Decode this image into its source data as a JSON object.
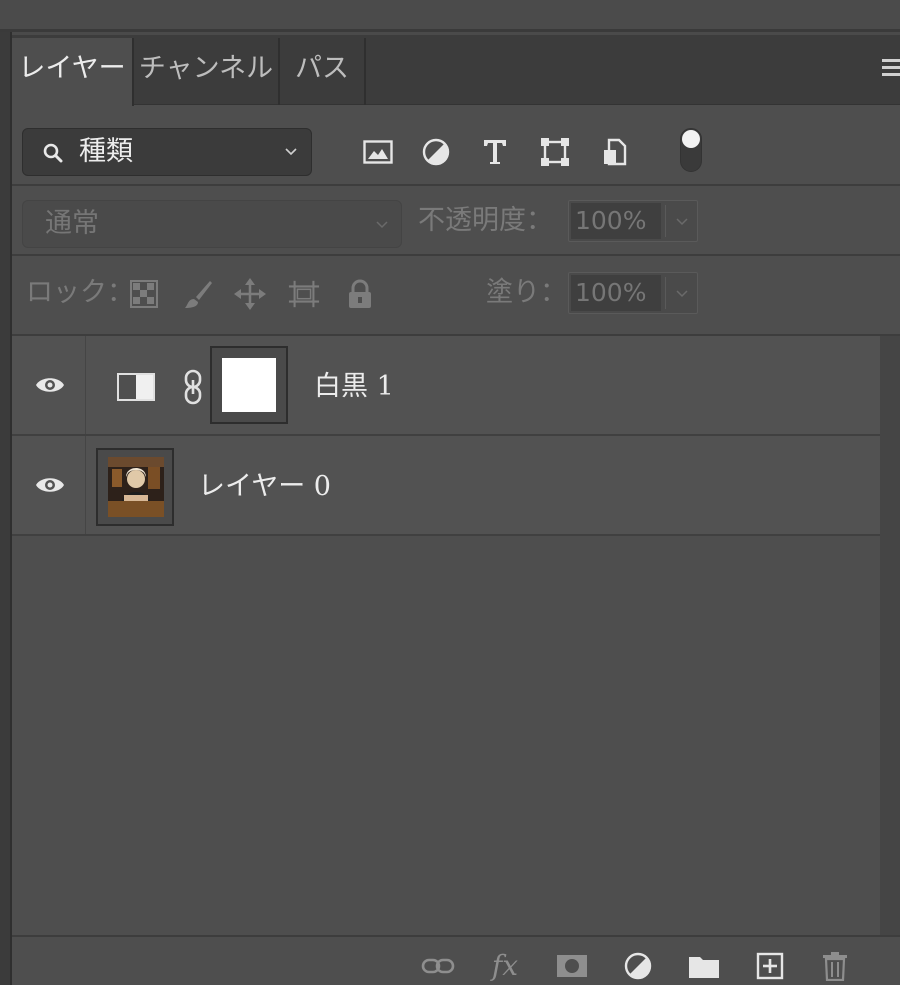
{
  "tabs": [
    {
      "label": "レイヤー",
      "active": true
    },
    {
      "label": "チャンネル",
      "active": false
    },
    {
      "label": "パス",
      "active": false
    }
  ],
  "filter": {
    "kind_label": "種類",
    "icons": [
      "image-filter-icon",
      "adjustment-filter-icon",
      "type-filter-icon",
      "shape-filter-icon",
      "smart-object-filter-icon",
      "filter-toggle"
    ]
  },
  "blend": {
    "mode": "通常",
    "opacity_label": "不透明度：",
    "opacity_value": "100%"
  },
  "lock": {
    "label": "ロック：",
    "icons": [
      "lock-transparent-pixels-icon",
      "lock-image-pixels-icon",
      "lock-position-icon",
      "lock-artboard-icon",
      "lock-all-icon"
    ],
    "fill_label": "塗り：",
    "fill_value": "100%"
  },
  "layers": [
    {
      "name": "白黒 1",
      "type": "adjustment",
      "visible": true
    },
    {
      "name": "レイヤー 0",
      "type": "pixel",
      "visible": true
    }
  ],
  "footer_icons": [
    "link-layers-icon",
    "fx-icon",
    "add-mask-icon",
    "new-adjustment-icon",
    "new-group-icon",
    "new-layer-icon",
    "delete-layer-icon"
  ],
  "footer_fx_label": "fx",
  "colors": {
    "panel_bg": "#4e4e4e",
    "tabbar_bg": "#3c3c3c",
    "layer_row_bg": "#525252",
    "text": "#ececec",
    "dim_text": "#767676"
  }
}
